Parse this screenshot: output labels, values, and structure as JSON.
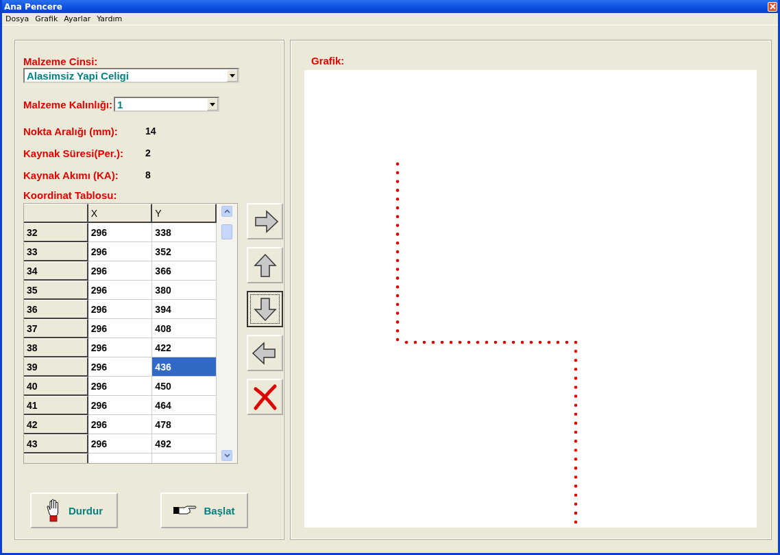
{
  "window": {
    "title": "Ana Pencere"
  },
  "menu": [
    "Dosya",
    "Grafik",
    "Ayarlar",
    "Yardım"
  ],
  "material": {
    "label": "Malzeme Cinsi:",
    "value": "Alasimsiz Yapi Celigi"
  },
  "thickness": {
    "label": "Malzeme Kalınlığı:",
    "value": "1"
  },
  "readouts": [
    {
      "label": "Nokta Aralığı (mm):",
      "value": "14"
    },
    {
      "label": "Kaynak Süresi(Per.):",
      "value": "2"
    },
    {
      "label": "Kaynak Akımı (KA):",
      "value": "8"
    }
  ],
  "table": {
    "title": "Koordinat Tablosu:",
    "columns": [
      "X",
      "Y"
    ],
    "rows": [
      {
        "header": "32",
        "cells": [
          {
            "text": "296",
            "selected": false
          },
          {
            "text": "338",
            "selected": false
          }
        ]
      },
      {
        "header": "33",
        "cells": [
          {
            "text": "296",
            "selected": false
          },
          {
            "text": "352",
            "selected": false
          }
        ]
      },
      {
        "header": "34",
        "cells": [
          {
            "text": "296",
            "selected": false
          },
          {
            "text": "366",
            "selected": false
          }
        ]
      },
      {
        "header": "35",
        "cells": [
          {
            "text": "296",
            "selected": false
          },
          {
            "text": "380",
            "selected": false
          }
        ]
      },
      {
        "header": "36",
        "cells": [
          {
            "text": "296",
            "selected": false
          },
          {
            "text": "394",
            "selected": false
          }
        ]
      },
      {
        "header": "37",
        "cells": [
          {
            "text": "296",
            "selected": false
          },
          {
            "text": "408",
            "selected": false
          }
        ]
      },
      {
        "header": "38",
        "cells": [
          {
            "text": "296",
            "selected": false
          },
          {
            "text": "422",
            "selected": false
          }
        ]
      },
      {
        "header": "39",
        "cells": [
          {
            "text": "296",
            "selected": false
          },
          {
            "text": "436",
            "selected": true
          }
        ]
      },
      {
        "header": "40",
        "cells": [
          {
            "text": "296",
            "selected": false
          },
          {
            "text": "450",
            "selected": false
          }
        ]
      },
      {
        "header": "41",
        "cells": [
          {
            "text": "296",
            "selected": false
          },
          {
            "text": "464",
            "selected": false
          }
        ]
      },
      {
        "header": "42",
        "cells": [
          {
            "text": "296",
            "selected": false
          },
          {
            "text": "478",
            "selected": false
          }
        ]
      },
      {
        "header": "43",
        "cells": [
          {
            "text": "296",
            "selected": false
          },
          {
            "text": "492",
            "selected": false
          }
        ]
      }
    ]
  },
  "move_buttons": [
    {
      "kind": "right",
      "focused": false
    },
    {
      "kind": "up",
      "focused": false
    },
    {
      "kind": "down",
      "focused": true
    },
    {
      "kind": "left",
      "focused": false
    },
    {
      "kind": "delete",
      "focused": false
    }
  ],
  "actions": [
    {
      "kind": "stop",
      "label": "Durdur"
    },
    {
      "kind": "start",
      "label": "Başlat"
    }
  ],
  "graph": {
    "title": "Grafik:"
  }
}
